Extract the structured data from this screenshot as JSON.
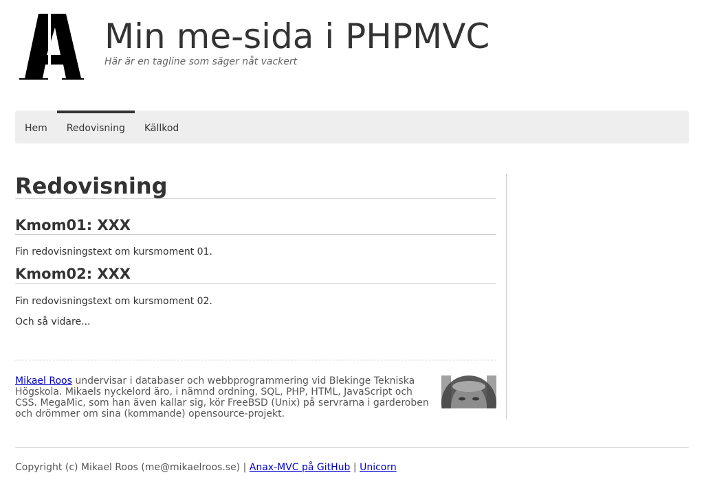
{
  "header": {
    "logo_icon": "stencil-letter-a-logo",
    "site_title": "Min me-sida i PHPMVC",
    "site_slogan": "Här är en tagline som säger nåt vackert"
  },
  "navbar": {
    "items": [
      {
        "label": "Hem",
        "selected": false
      },
      {
        "label": "Redovisning",
        "selected": true
      },
      {
        "label": "Källkod",
        "selected": false
      }
    ]
  },
  "main": {
    "title": "Redovisning",
    "sections": [
      {
        "heading": "Kmom01: XXX",
        "text": "Fin redovisningstext om kursmoment 01."
      },
      {
        "heading": "Kmom02: XXX",
        "text": "Fin redovisningstext om kursmoment 02."
      }
    ],
    "closing": "Och så vidare..."
  },
  "byline": {
    "author_link": "Mikael Roos",
    "text": " undervisar i databaser och webbprogrammering vid Blekinge Tekniska Högskola. Mikaels nyckelord äro, i nämnd ordning, SQL, PHP, HTML, JavaScript och CSS. MegaMic, som han även kallar sig, kör FreeBSD (Unix) på servrarna i garderoben och drömmer om sina (kommande) opensource-projekt.",
    "avatar_icon": "author-portrait"
  },
  "footer": {
    "copyright": "Copyright (c) Mikael Roos (me@mikaelroos.se) | ",
    "link_github": "Anax-MVC på GitHub",
    "separator": " | ",
    "link_unicorn": "Unicorn"
  },
  "colors": {
    "text": "#333333",
    "navbar_bg": "#eeeeee",
    "link": "#0000cc",
    "rule": "#cccccc"
  }
}
